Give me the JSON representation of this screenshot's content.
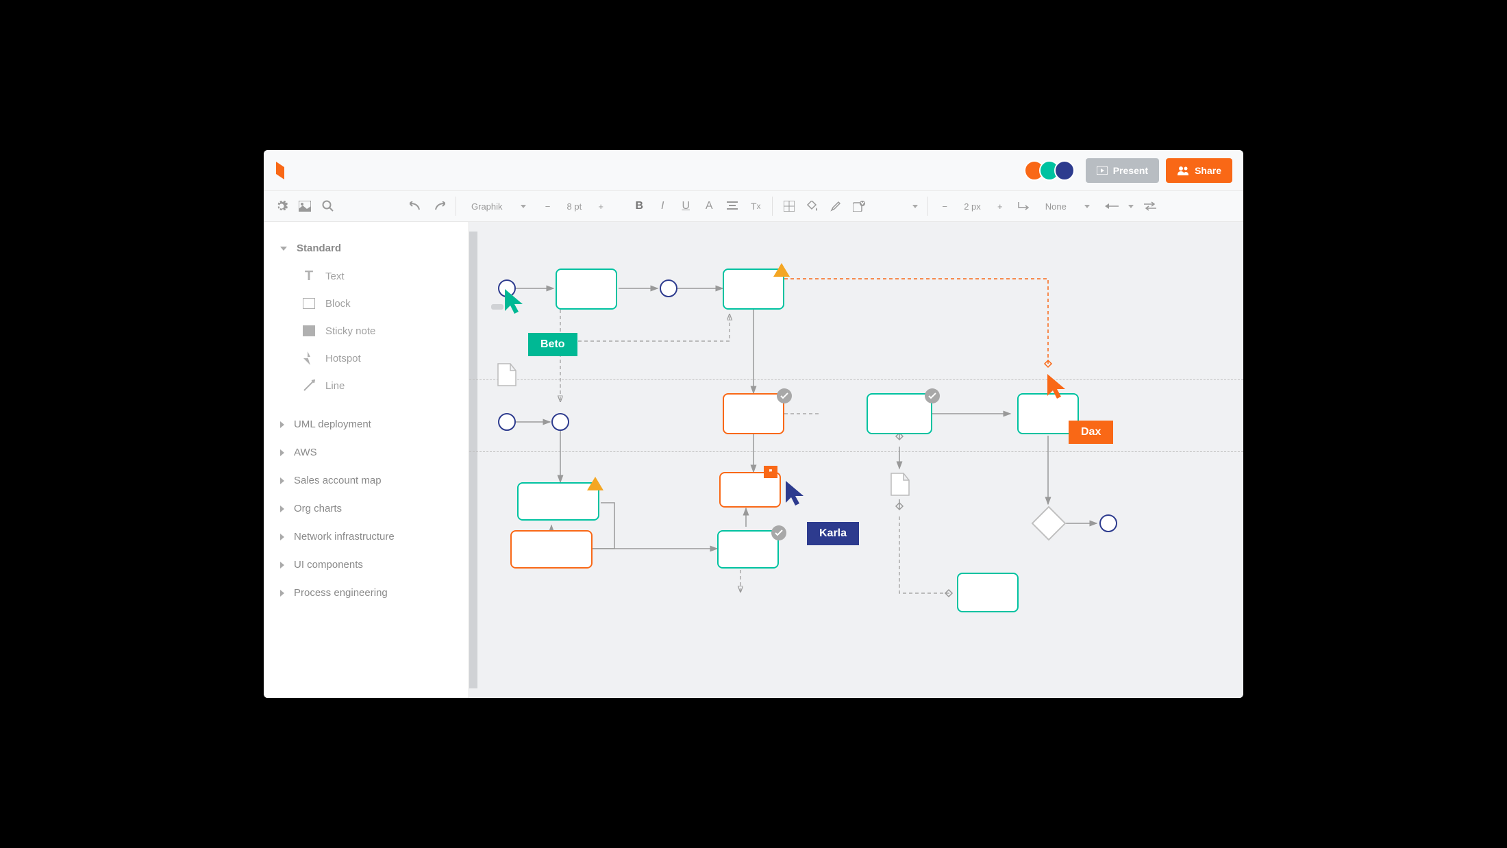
{
  "header": {
    "present_label": "Present",
    "share_label": "Share",
    "avatars": [
      {
        "color": "#f96816"
      },
      {
        "color": "#00c2a0"
      },
      {
        "color": "#2d3b8e"
      }
    ]
  },
  "toolbar": {
    "font_family": "Graphik",
    "font_size": "8 pt",
    "line_width": "2 px",
    "line_style": "None"
  },
  "sidebar": {
    "expanded_group": "Standard",
    "shape_items": [
      {
        "label": "Text",
        "icon": "text-icon"
      },
      {
        "label": "Block",
        "icon": "block-icon"
      },
      {
        "label": "Sticky note",
        "icon": "sticky-icon"
      },
      {
        "label": "Hotspot",
        "icon": "hotspot-icon"
      },
      {
        "label": "Line",
        "icon": "line-icon"
      }
    ],
    "collapsed_groups": [
      "UML deployment",
      "AWS",
      "Sales account map",
      "Org charts",
      "Network infrastructure",
      "UI components",
      "Process engineering"
    ]
  },
  "collaborators": [
    {
      "name": "Beto",
      "color": "#00b894"
    },
    {
      "name": "Karla",
      "color": "#2d3b8e"
    },
    {
      "name": "Dax",
      "color": "#f96816"
    }
  ],
  "colors": {
    "teal": "#00c2a0",
    "orange": "#f96816",
    "navy": "#2d3b8e",
    "gray": "#aaaaaa"
  }
}
